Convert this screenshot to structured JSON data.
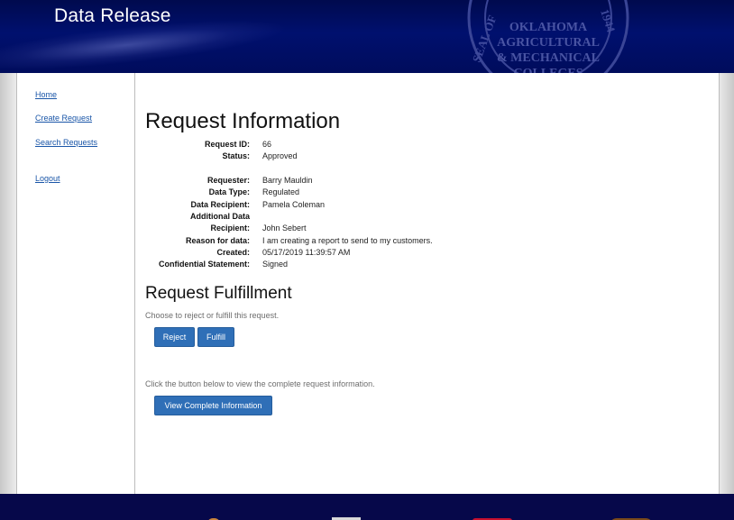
{
  "header": {
    "title": "Data Release",
    "seal_text": "OKLAHOMA AGRICULTURAL & MECHANICAL COLLEGES",
    "seal_ring_left": "SEAL OF",
    "seal_ring_right": "1944"
  },
  "sidebar": {
    "items": [
      {
        "label": "Home"
      },
      {
        "label": "Create Request"
      },
      {
        "label": "Search Requests"
      },
      {
        "label": "Logout"
      }
    ]
  },
  "request_info": {
    "heading": "Request Information",
    "rows": [
      {
        "label": "Request ID:",
        "value": "66"
      },
      {
        "label": "Status:",
        "value": "Approved"
      },
      {
        "label": "Requester:",
        "value": "Barry Mauldin"
      },
      {
        "label": "Data Type:",
        "value": "Regulated"
      },
      {
        "label": "Data Recipient:",
        "value": "Pamela Coleman"
      },
      {
        "label": "Additional Data",
        "value": ""
      },
      {
        "label": "Recipient:",
        "value": "John Sebert"
      },
      {
        "label": "Reason for data:",
        "value": "I am creating a report to send to my customers."
      },
      {
        "label": "Created:",
        "value": "05/17/2019 11:39:57 AM"
      },
      {
        "label": "Confidential Statement:",
        "value": "Signed"
      }
    ]
  },
  "fulfillment": {
    "heading": "Request Fulfillment",
    "instruction": "Choose to reject or fulfill this request.",
    "reject_label": "Reject",
    "fulfill_label": "Fulfill",
    "view_hint": "Click the button below to view the complete request information.",
    "view_label": "View Complete Information"
  },
  "colors": {
    "header_bg": "#000c5c",
    "link": "#1a56a8",
    "button": "#2f6fb7",
    "footer_bg": "#06084a"
  }
}
